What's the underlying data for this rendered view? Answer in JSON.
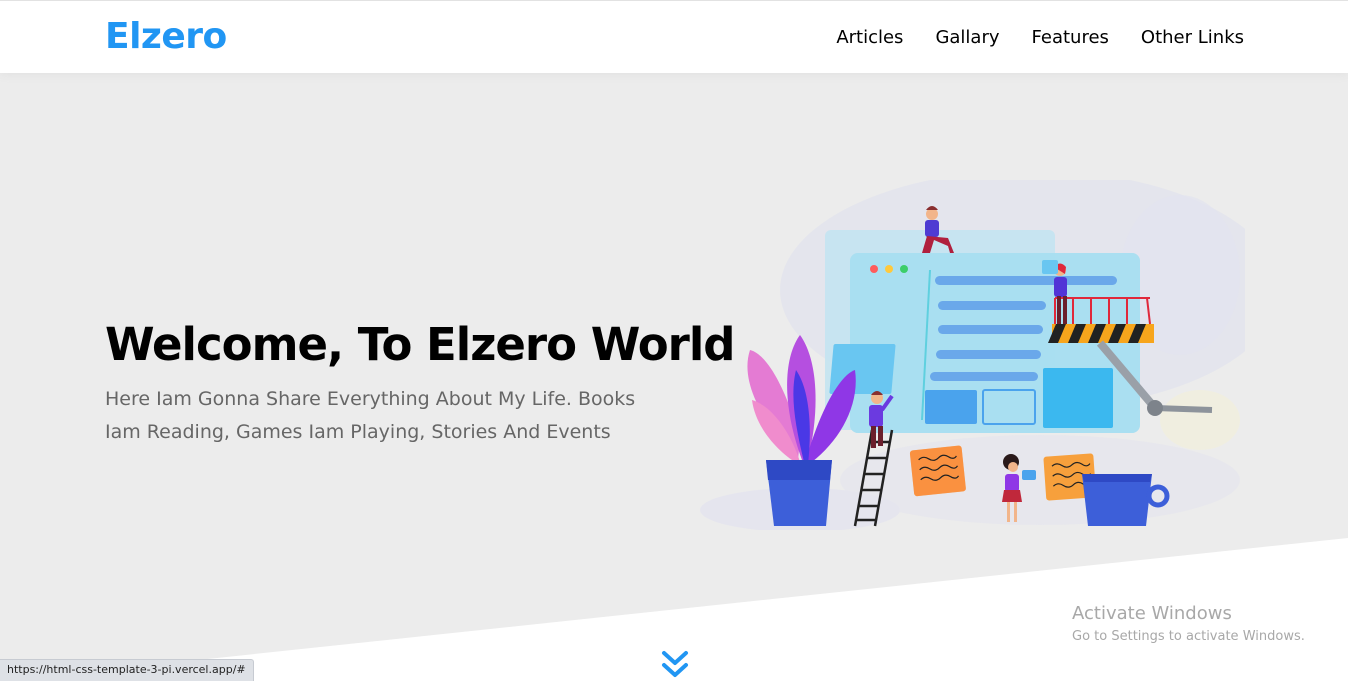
{
  "header": {
    "logo": "Elzero",
    "nav": [
      "Articles",
      "Gallary",
      "Features",
      "Other Links"
    ]
  },
  "hero": {
    "title": "Welcome, To Elzero World",
    "text": "Here Iam Gonna Share Everything About My Life. Books Iam Reading, Games Iam Playing, Stories And Events"
  },
  "watermark": {
    "line1": "Activate Windows",
    "line2": "Go to Settings to activate Windows."
  },
  "statusbar": {
    "url": "https://html-css-template-3-pi.vercel.app/#"
  },
  "colors": {
    "brand": "#2196f3",
    "hero_bg": "#ececec",
    "text_muted": "#666666"
  },
  "icons": {
    "scroll_down": "double-chevron-down-icon"
  }
}
